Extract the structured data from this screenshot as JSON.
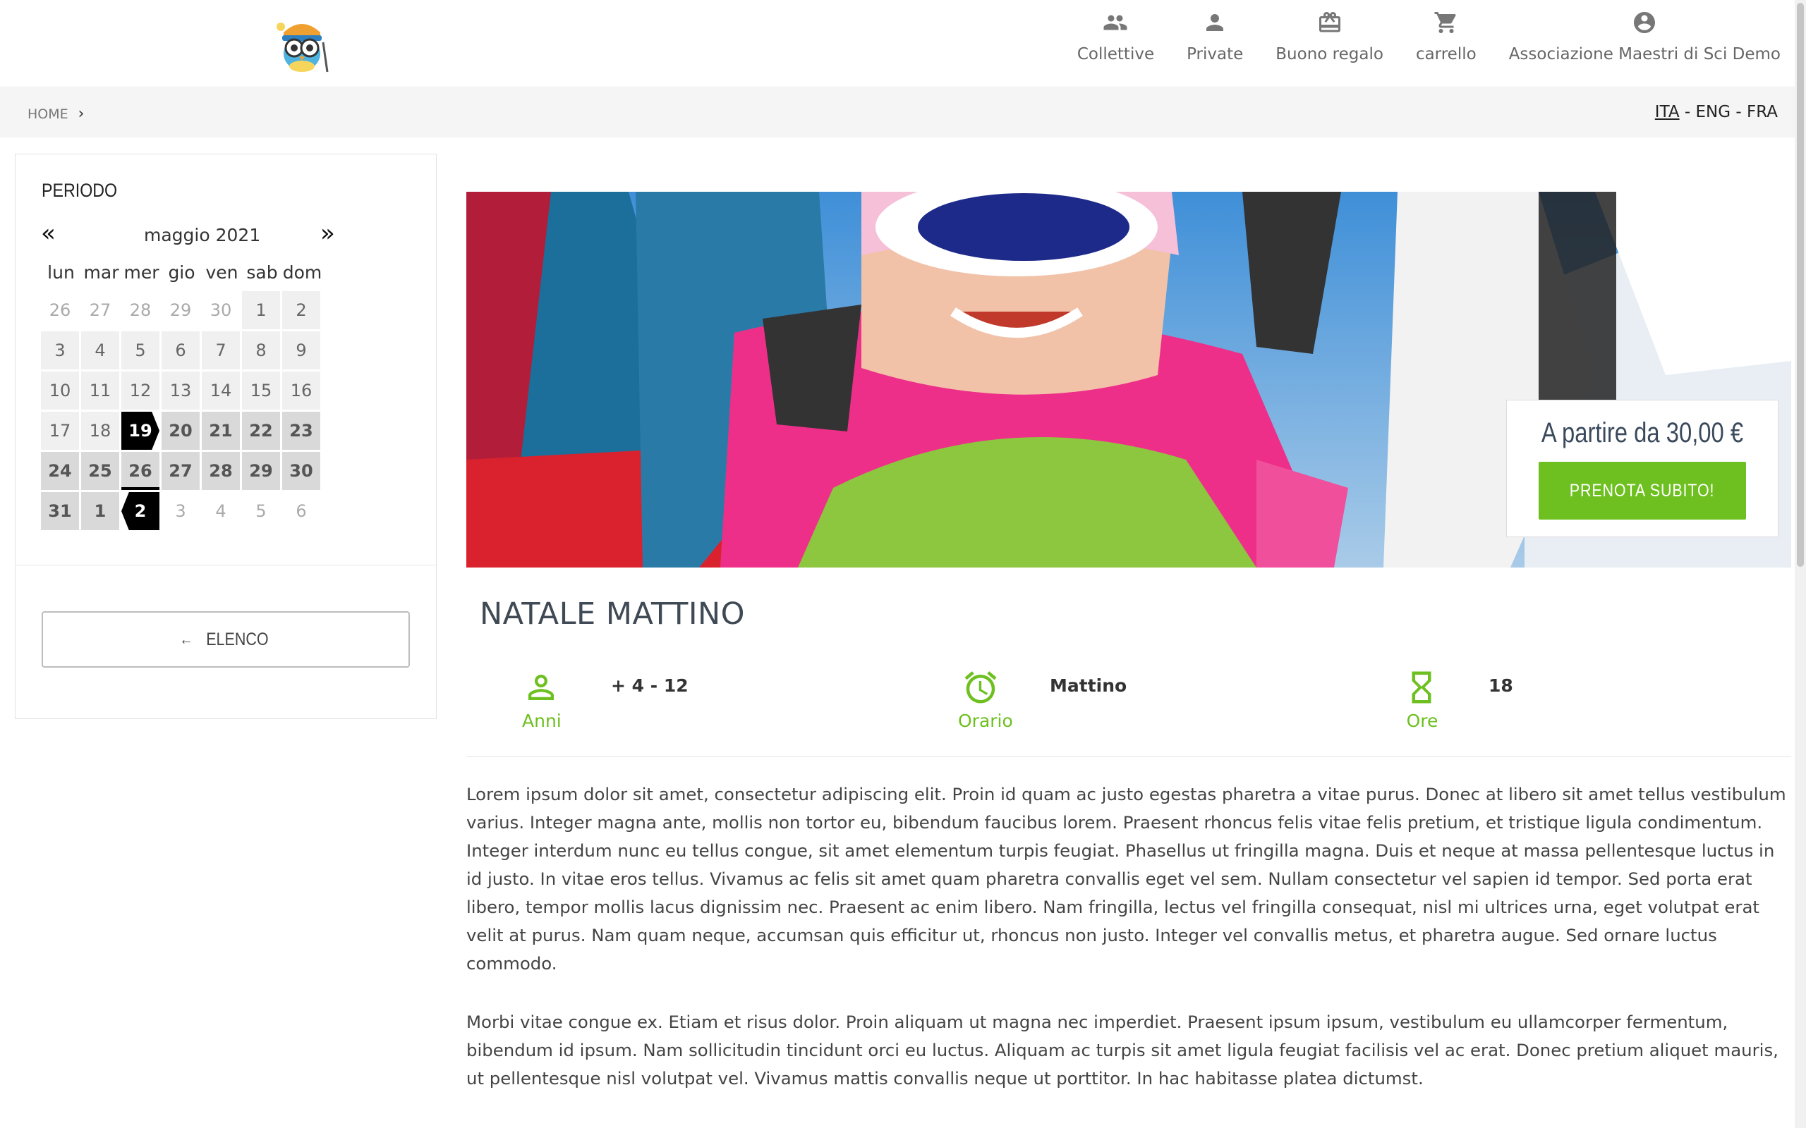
{
  "nav": [
    {
      "label": "Collettive",
      "icon": "group-icon"
    },
    {
      "label": "Private",
      "icon": "person-icon"
    },
    {
      "label": "Buono regalo",
      "icon": "gift-card-icon"
    },
    {
      "label": "carrello",
      "icon": "cart-icon"
    },
    {
      "label": "Associazione Maestri di Sci Demo",
      "icon": "account-circle-icon"
    }
  ],
  "breadcrumb": {
    "home": "HOME",
    "separator": "›"
  },
  "languages": {
    "ita": "ITA",
    "eng": "ENG",
    "fra": "FRA",
    "sep": " - "
  },
  "sidebar": {
    "title": "PERIODO",
    "prev": "«",
    "next": "»",
    "month": "maggio 2021",
    "weekdays": [
      "lun",
      "mar",
      "mer",
      "gio",
      "ven",
      "sab",
      "dom"
    ],
    "days": [
      {
        "d": "26",
        "t": "out"
      },
      {
        "d": "27",
        "t": "out"
      },
      {
        "d": "28",
        "t": "out"
      },
      {
        "d": "29",
        "t": "out"
      },
      {
        "d": "30",
        "t": "out"
      },
      {
        "d": "1",
        "t": "past"
      },
      {
        "d": "2",
        "t": "past"
      },
      {
        "d": "3",
        "t": "past"
      },
      {
        "d": "4",
        "t": "past"
      },
      {
        "d": "5",
        "t": "past"
      },
      {
        "d": "6",
        "t": "past"
      },
      {
        "d": "7",
        "t": "past"
      },
      {
        "d": "8",
        "t": "past"
      },
      {
        "d": "9",
        "t": "past"
      },
      {
        "d": "10",
        "t": "past"
      },
      {
        "d": "11",
        "t": "past"
      },
      {
        "d": "12",
        "t": "past"
      },
      {
        "d": "13",
        "t": "past"
      },
      {
        "d": "14",
        "t": "past"
      },
      {
        "d": "15",
        "t": "past"
      },
      {
        "d": "16",
        "t": "past"
      },
      {
        "d": "17",
        "t": "past"
      },
      {
        "d": "18",
        "t": "past"
      },
      {
        "d": "19",
        "t": "sel-start"
      },
      {
        "d": "20",
        "t": "avail"
      },
      {
        "d": "21",
        "t": "avail"
      },
      {
        "d": "22",
        "t": "avail"
      },
      {
        "d": "23",
        "t": "avail"
      },
      {
        "d": "24",
        "t": "avail"
      },
      {
        "d": "25",
        "t": "avail"
      },
      {
        "d": "26",
        "t": "avail-mark"
      },
      {
        "d": "27",
        "t": "avail"
      },
      {
        "d": "28",
        "t": "avail"
      },
      {
        "d": "29",
        "t": "avail"
      },
      {
        "d": "30",
        "t": "avail"
      },
      {
        "d": "31",
        "t": "avail"
      },
      {
        "d": "1",
        "t": "avail"
      },
      {
        "d": "2",
        "t": "sel-end"
      },
      {
        "d": "3",
        "t": "out"
      },
      {
        "d": "4",
        "t": "out"
      },
      {
        "d": "5",
        "t": "out"
      },
      {
        "d": "6",
        "t": "out"
      }
    ],
    "list_button": "ELENCO",
    "list_arrow": "←"
  },
  "hero": {
    "price": "A partire da 30,00 €",
    "book_button": "PRENOTA SUBITO!"
  },
  "course": {
    "title": "NATALE MATTINO",
    "info": [
      {
        "label": "Anni",
        "value": "+ 4 - 12",
        "icon": "person-outline-icon"
      },
      {
        "label": "Orario",
        "value": "Mattino",
        "icon": "alarm-icon"
      },
      {
        "label": "Ore",
        "value": "18",
        "icon": "hourglass-icon"
      }
    ],
    "description": [
      "Lorem ipsum dolor sit amet, consectetur adipiscing elit. Proin id quam ac justo egestas pharetra a vitae purus. Donec at libero sit amet tellus vestibulum varius. Integer magna ante, mollis non tortor eu, bibendum faucibus lorem. Praesent rhoncus felis vitae felis pretium, et tristique ligula condimentum. Integer interdum nunc eu tellus congue, sit amet elementum turpis feugiat. Phasellus ut fringilla magna. Duis et neque at massa pellentesque luctus in id justo. In vitae eros tellus. Vivamus ac felis sit amet quam pharetra convallis eget vel sem. Nullam consectetur vel sapien id tempor. Sed porta erat libero, tempor mollis lacus dignissim nec. Praesent ac enim libero. Nam fringilla, lectus vel fringilla consequat, nisl mi ultrices urna, eget volutpat erat velit at purus. Nam quam neque, accumsan quis efficitur ut, rhoncus non justo. Integer vel convallis metus, et pharetra augue. Sed ornare luctus commodo.",
      "Morbi vitae congue ex. Etiam et risus dolor. Proin aliquam ut magna nec imperdiet. Praesent ipsum ipsum, vestibulum eu ullamcorper fermentum, bibendum id ipsum. Nam sollicitudin tincidunt orci eu luctus. Aliquam ac turpis sit amet ligula feugiat facilisis vel ac erat. Donec pretium aliquet mauris, ut pellentesque nisl volutpat vel. Vivamus mattis convallis neque ut porttitor. In hac habitasse platea dictumst."
    ]
  },
  "colors": {
    "accent": "#6dc01f",
    "title": "#3f4a55",
    "selected": "#000000"
  }
}
